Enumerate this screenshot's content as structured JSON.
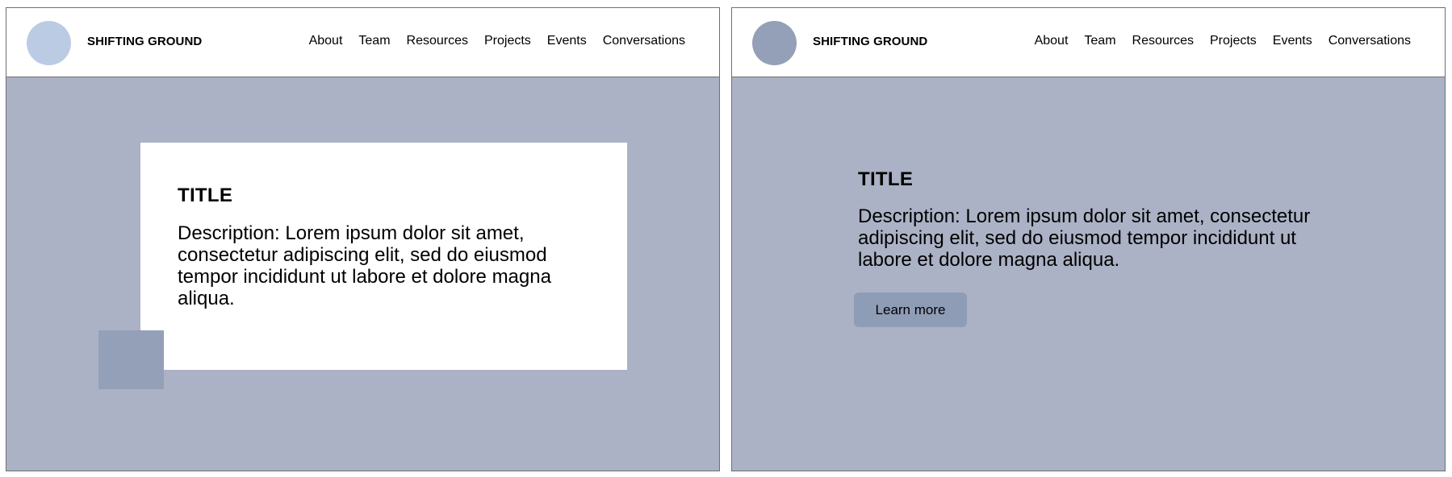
{
  "frames": [
    {
      "brand": "SHIFTING GROUND",
      "nav": [
        "About",
        "Team",
        "Resources",
        "Projects",
        "Events",
        "Conversations"
      ],
      "hero": {
        "title": "TITLE",
        "description": "Description: Lorem ipsum dolor sit amet, consectetur adipiscing elit, sed do eiusmod tempor incididunt ut labore et dolore magna aliqua."
      }
    },
    {
      "brand": "SHIFTING GROUND",
      "nav": [
        "About",
        "Team",
        "Resources",
        "Projects",
        "Events",
        "Conversations"
      ],
      "hero": {
        "title": "TITLE",
        "description": "Description: Lorem ipsum dolor sit amet, consectetur adipiscing elit, sed do eiusmod tempor incididunt ut labore et dolore magna aliqua.",
        "button_label": "Learn more"
      }
    }
  ],
  "colors": {
    "background": "#abb2c5",
    "logo_light": "#bccbe4",
    "logo_dark": "#93a0b8",
    "accent": "#93a0b8",
    "button": "#8f9cb6"
  }
}
